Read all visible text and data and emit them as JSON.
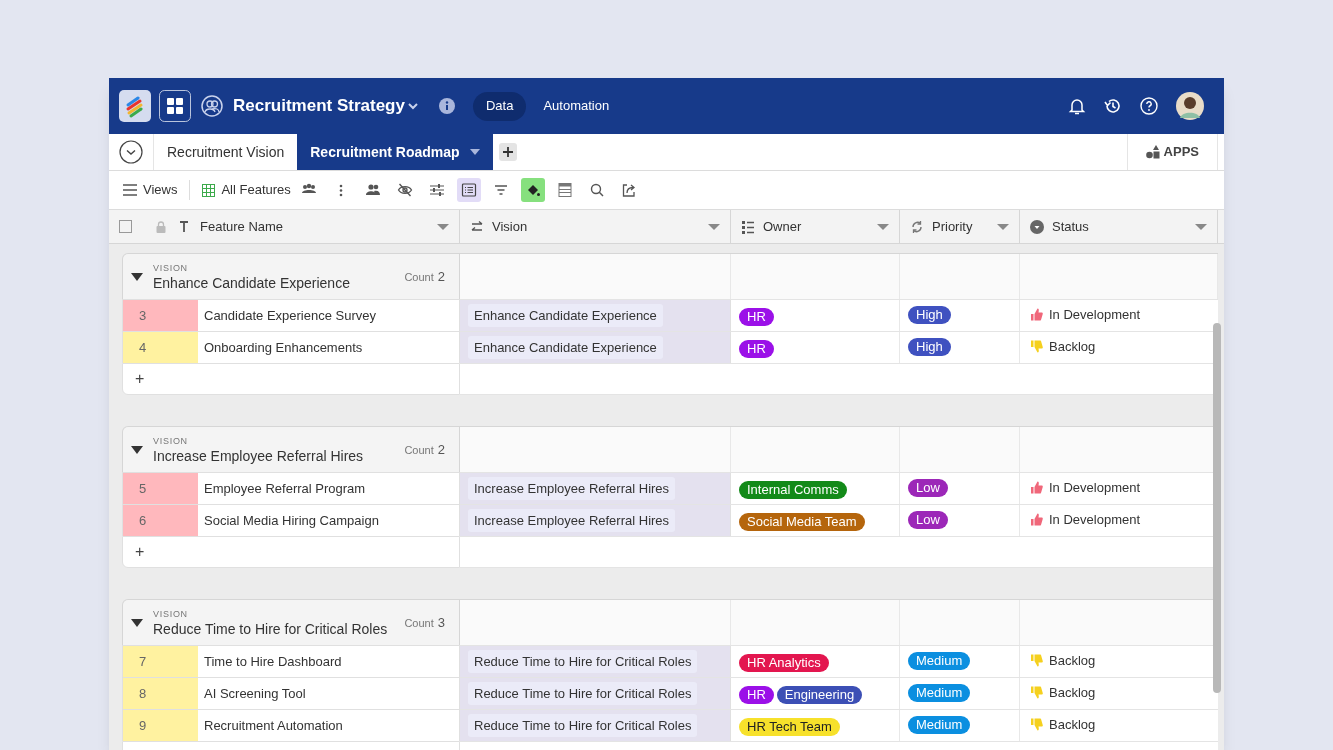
{
  "header": {
    "title": "Recruitment Strategy",
    "nav": [
      {
        "label": "Data",
        "selected": true
      },
      {
        "label": "Automation",
        "selected": false
      }
    ]
  },
  "tabs": [
    {
      "label": "Recruitment Vision",
      "selected": false
    },
    {
      "label": "Recruitment Roadmap",
      "selected": true
    }
  ],
  "apps_button": "APPS",
  "select_all_checked": false,
  "toolbar": {
    "views": "Views",
    "view_name": "All Features",
    "tools": [
      {
        "kind": "members",
        "on": false
      },
      {
        "kind": "more",
        "on": false
      },
      {
        "kind": "people",
        "on": false
      },
      {
        "kind": "hide",
        "on": false
      },
      {
        "kind": "sliders",
        "on": false
      },
      {
        "kind": "list",
        "on": true
      },
      {
        "kind": "filter",
        "on": false
      },
      {
        "kind": "paint",
        "on": true
      },
      {
        "kind": "rows",
        "on": false
      },
      {
        "kind": "search",
        "on": false
      },
      {
        "kind": "share",
        "on": false
      }
    ]
  },
  "columns": [
    {
      "kind": "text",
      "label": "Feature Name"
    },
    {
      "kind": "link",
      "label": "Vision"
    },
    {
      "kind": "list",
      "label": "Owner"
    },
    {
      "kind": "cycle",
      "label": "Priority"
    },
    {
      "kind": "status",
      "label": "Status"
    }
  ],
  "groups": [
    {
      "label": "VISION",
      "title": "Enhance Candidate Experience",
      "count_label": "Count",
      "count": "2",
      "expanded": true,
      "add_button": "+",
      "rows": [
        {
          "number": "3",
          "color": "#ffb8bd",
          "name": "Candidate Experience Survey",
          "vision": "Enhance Candidate Experience",
          "owners": [
            {
              "text": "HR",
              "color": "#9b10e8"
            }
          ],
          "priority": {
            "text": "High",
            "color": "#3f51c0"
          },
          "status": {
            "kind": "up",
            "text": "In Development"
          }
        },
        {
          "number": "4",
          "color": "#fff2a0",
          "name": "Onboarding Enhancements",
          "vision": "Enhance Candidate Experience",
          "owners": [
            {
              "text": "HR",
              "color": "#9b10e8"
            }
          ],
          "priority": {
            "text": "High",
            "color": "#3f51c0"
          },
          "status": {
            "kind": "down",
            "text": "Backlog"
          }
        }
      ]
    },
    {
      "label": "VISION",
      "title": "Increase Employee Referral Hires",
      "count_label": "Count",
      "count": "2",
      "expanded": true,
      "add_button": "+",
      "rows": [
        {
          "number": "5",
          "color": "#ffb8bd",
          "name": "Employee Referral Program",
          "vision": "Increase Employee Referral Hires",
          "owners": [
            {
              "text": "Internal Comms",
              "color": "#138a19"
            }
          ],
          "priority": {
            "text": "Low",
            "color": "#9c27b8"
          },
          "status": {
            "kind": "up",
            "text": "In Development"
          }
        },
        {
          "number": "6",
          "color": "#ffb8bd",
          "name": "Social Media Hiring Campaign",
          "vision": "Increase Employee Referral Hires",
          "owners": [
            {
              "text": "Social Media Team",
              "color": "#b5650c"
            }
          ],
          "priority": {
            "text": "Low",
            "color": "#9c27b8"
          },
          "status": {
            "kind": "up",
            "text": "In Development"
          }
        }
      ]
    },
    {
      "label": "VISION",
      "title": "Reduce Time to Hire for Critical Roles",
      "count_label": "Count",
      "count": "3",
      "expanded": true,
      "rows": [
        {
          "number": "7",
          "color": "#fff2a0",
          "name": "Time to Hire Dashboard",
          "vision": "Reduce Time to Hire for Critical Roles",
          "owners": [
            {
              "text": "HR Analytics",
              "color": "#e3164f"
            }
          ],
          "priority": {
            "text": "Medium",
            "color": "#0b8fe0"
          },
          "status": {
            "kind": "down",
            "text": "Backlog"
          }
        },
        {
          "number": "8",
          "color": "#fff2a0",
          "name": "AI Screening Tool",
          "vision": "Reduce Time to Hire for Critical Roles",
          "owners": [
            {
              "text": "HR",
              "color": "#9b10e8"
            },
            {
              "text": "Engineering",
              "color": "#3c4fb5"
            }
          ],
          "priority": {
            "text": "Medium",
            "color": "#0b8fe0"
          },
          "status": {
            "kind": "down",
            "text": "Backlog"
          }
        },
        {
          "number": "9",
          "color": "#fff2a0",
          "name": "Recruitment Automation",
          "vision": "Reduce Time to Hire for Critical Roles",
          "owners": [
            {
              "text": "HR Tech Team",
              "color": "#f7e12b"
            }
          ],
          "priority": {
            "text": "Medium",
            "color": "#0b8fe0"
          },
          "status": {
            "kind": "down",
            "text": "Backlog"
          }
        }
      ]
    }
  ]
}
